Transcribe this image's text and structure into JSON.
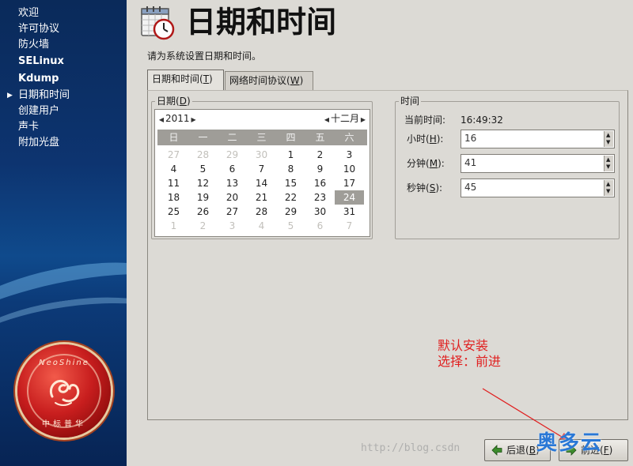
{
  "sidebar": {
    "items": [
      {
        "label": "欢迎",
        "bold": false,
        "current": false
      },
      {
        "label": "许可协议",
        "bold": false,
        "current": false
      },
      {
        "label": "防火墙",
        "bold": false,
        "current": false
      },
      {
        "label": "SELinux",
        "bold": true,
        "current": false
      },
      {
        "label": "Kdump",
        "bold": true,
        "current": false
      },
      {
        "label": "日期和时间",
        "bold": false,
        "current": true
      },
      {
        "label": "创建用户",
        "bold": false,
        "current": false
      },
      {
        "label": "声卡",
        "bold": false,
        "current": false
      },
      {
        "label": "附加光盘",
        "bold": false,
        "current": false
      }
    ],
    "logo": {
      "brand_en": "NeoShine",
      "brand_cn": "中标普华"
    }
  },
  "header": {
    "title": "日期和时间",
    "instruction": "请为系统设置日期和时间。",
    "icon": "calendar-clock-icon"
  },
  "tabs": [
    {
      "label": "日期和时间",
      "key": "T",
      "active": true
    },
    {
      "label": "网络时间协议",
      "key": "W",
      "active": false
    }
  ],
  "date_group": {
    "legend": "日期",
    "key": "D",
    "year": "2011",
    "month": "十二月",
    "weekdays": [
      "日",
      "一",
      "二",
      "三",
      "四",
      "五",
      "六"
    ],
    "weeks": [
      [
        {
          "d": "27",
          "m": true
        },
        {
          "d": "28",
          "m": true
        },
        {
          "d": "29",
          "m": true
        },
        {
          "d": "30",
          "m": true
        },
        {
          "d": "1"
        },
        {
          "d": "2"
        },
        {
          "d": "3"
        }
      ],
      [
        {
          "d": "4"
        },
        {
          "d": "5"
        },
        {
          "d": "6"
        },
        {
          "d": "7"
        },
        {
          "d": "8"
        },
        {
          "d": "9"
        },
        {
          "d": "10"
        }
      ],
      [
        {
          "d": "11"
        },
        {
          "d": "12"
        },
        {
          "d": "13"
        },
        {
          "d": "14"
        },
        {
          "d": "15"
        },
        {
          "d": "16"
        },
        {
          "d": "17"
        }
      ],
      [
        {
          "d": "18"
        },
        {
          "d": "19"
        },
        {
          "d": "20"
        },
        {
          "d": "21"
        },
        {
          "d": "22"
        },
        {
          "d": "23"
        },
        {
          "d": "24",
          "s": true
        }
      ],
      [
        {
          "d": "25"
        },
        {
          "d": "26"
        },
        {
          "d": "27"
        },
        {
          "d": "28"
        },
        {
          "d": "29"
        },
        {
          "d": "30"
        },
        {
          "d": "31"
        }
      ],
      [
        {
          "d": "1",
          "m": true
        },
        {
          "d": "2",
          "m": true
        },
        {
          "d": "3",
          "m": true
        },
        {
          "d": "4",
          "m": true
        },
        {
          "d": "5",
          "m": true
        },
        {
          "d": "6",
          "m": true
        },
        {
          "d": "7",
          "m": true
        }
      ]
    ]
  },
  "time_group": {
    "legend": "时间",
    "current_label": "当前时间:",
    "current_value": "16:49:32",
    "fields": [
      {
        "label": "小时",
        "key": "H",
        "value": "16"
      },
      {
        "label": "分钟",
        "key": "M",
        "value": "41"
      },
      {
        "label": "秒钟",
        "key": "S",
        "value": "45"
      }
    ]
  },
  "annotation": {
    "line1": "默认安装",
    "line2": "选择：前进",
    "color": "#e02020"
  },
  "buttons": {
    "back": {
      "label": "后退",
      "key": "B"
    },
    "next": {
      "label": "前进",
      "key": "F"
    }
  },
  "watermark": {
    "url": "http://blog.csdn",
    "brand": "奥多云"
  }
}
